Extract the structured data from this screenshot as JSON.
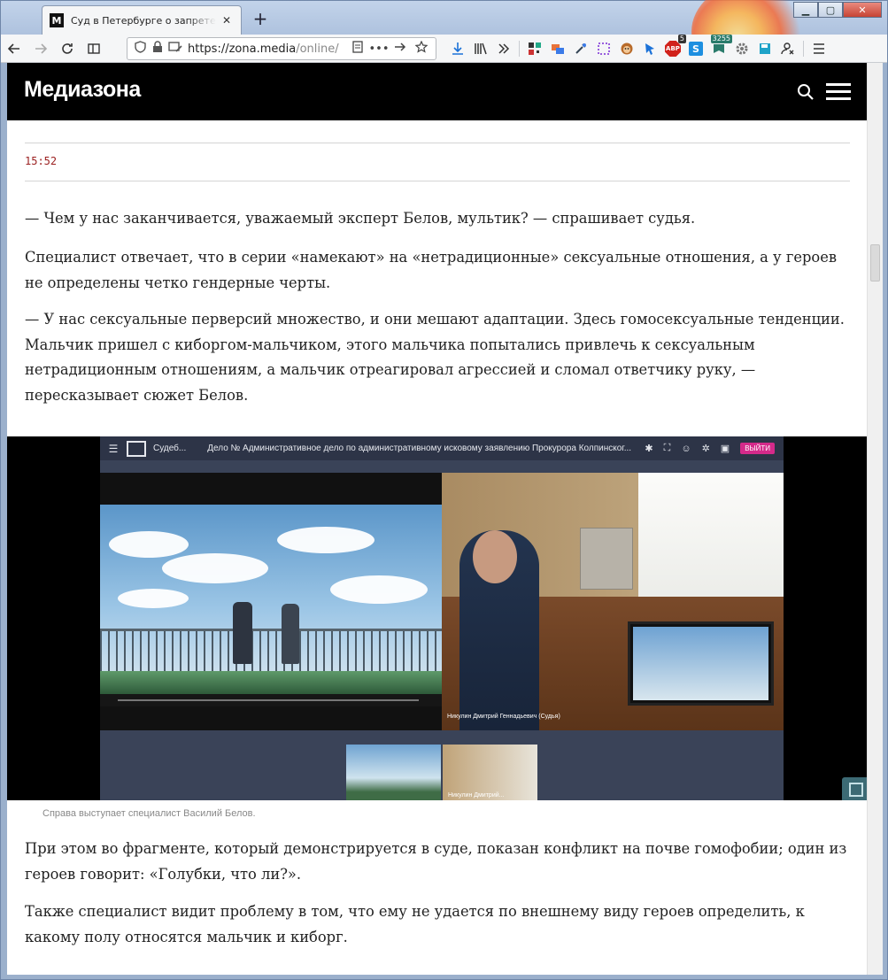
{
  "browser": {
    "tab_title": "Суд в Петербурге о запрете аниме",
    "tab_favicon_letter": "M",
    "tab_close": "✕",
    "new_tab": "+",
    "window_controls": {
      "minimize": "▁",
      "maximize": "▢",
      "close": "✕"
    },
    "url_host": "https://zona.media",
    "url_path": "/online/",
    "url_more": "•••",
    "extension_badges": {
      "abp_count": "5",
      "counter": "3255"
    }
  },
  "site": {
    "logo": "Медиазона"
  },
  "article": {
    "timestamp": "15:52",
    "paragraphs": [
      "— Чем у нас заканчивается, уважаемый эксперт Белов, мультик? — спрашивает судья.",
      "Специалист отвечает, что в серии «намекают» на «нетрадиционные» сексуальные отношения, а у героев не определены четко гендерные черты.",
      "— У нас сексуальные перверсий множество, и они мешают адаптации. Здесь гомосексуальные тенденции. Мальчик пришел с киборгом-мальчиком, этого мальчика попытались привлечь к сексуальным нетрадиционным отношениям, а мальчик отреагировал агрессией и сломал ответчику руку, — пересказывает сюжет Белов."
    ],
    "photo": {
      "vc_court": "Судеб...",
      "vc_case": "Дело № Административное дело по административному исковому заявлению Прокурора Колпинског...",
      "vc_exit": "ВЫЙТИ",
      "vc_speaker": "Никулин Дмитрий Геннадьевич (Судья)",
      "vc_thumb_label": "Никулин Дмитрий..."
    },
    "caption": "Справа выступает специалист Василий Белов.",
    "paragraphs_after": [
      "При этом во фрагменте, который демонстрируется в суде, показан конфликт на почве гомофобии; один из героев говорит: «Голубки, что ли?».",
      "Также специалист видит проблему в том, что ему не удается по внешнему виду героев определить, к какому полу относятся мальчик и киборг."
    ]
  }
}
